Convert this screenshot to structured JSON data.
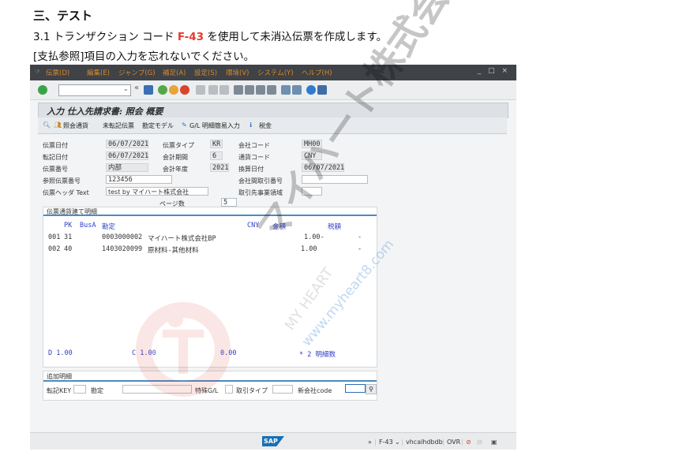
{
  "doc": {
    "heading": "三、テスト",
    "line1_pre": "3.1 トランザクション コード ",
    "line1_tcode": "F-43",
    "line1_post": " を使用して未消込伝票を作成します。",
    "line2": "[支払参照]項目の入力を忘れないでください。"
  },
  "menu": {
    "items": [
      "伝票(D)",
      "編集(E)",
      "ジャンプ(G)",
      "補足(A)",
      "設定(S)",
      "環境(V)",
      "システム(Y)",
      "ヘルプ(H)"
    ]
  },
  "screen": {
    "title": "入力 仕入先請求書: 照会 概要",
    "app_toolbar": [
      "照会通貨",
      "未転記伝票",
      "勘定モデル",
      "G/L 明細簡易入力",
      "税金"
    ]
  },
  "header": {
    "doc_date_label": "伝票日付",
    "doc_date": "06/07/2021",
    "doc_type_label": "伝票タイプ",
    "doc_type": "KR",
    "company_code_label": "会社コード",
    "company_code": "MH00",
    "posting_date_label": "転記日付",
    "posting_date": "06/07/2021",
    "period_label": "会計期間",
    "period": "6",
    "currency_label": "通貨コード",
    "currency": "CNY",
    "doc_no_label": "伝票番号",
    "doc_no": "内部",
    "fiscal_year_label": "会計年度",
    "fiscal_year": "2021",
    "translation_date_label": "換算日付",
    "translation_date": "06/07/2021",
    "reference_label": "参照伝票番号",
    "reference": "123456",
    "intercompany_label": "会社間取引番号",
    "intercompany": "",
    "header_text_label": "伝票ヘッダ Text",
    "header_text": "test by マイハート株式会社",
    "trading_partner_label": "取引先事業領域",
    "trading_partner": "",
    "pages_label": "ページ数",
    "pages": "5"
  },
  "items": {
    "section_title": "伝票通貨建て明細",
    "col_pk": "PK",
    "col_busa": "BusA",
    "col_account": "勘定",
    "col_currency": "CNY",
    "col_amount": "金額",
    "col_tax": "税額",
    "rows": [
      {
        "no": "001",
        "pk": "31",
        "account": "0003000002",
        "name": "マイハート株式会社BP",
        "amount": "1.00-",
        "tax": "-"
      },
      {
        "no": "002",
        "pk": "40",
        "account": "1403020099",
        "name": "原材料-其他材料",
        "amount": "1.00",
        "tax": "-"
      }
    ],
    "debit": "D 1.00",
    "credit": "C 1.00",
    "balance": "0.00",
    "items_count_label": "*   2 明細数"
  },
  "additional": {
    "section_title": "追加明細",
    "posting_key_label": "転記KEY",
    "account_label": "勘定",
    "special_gl_label": "特殊G/L",
    "trans_type_label": "取引タイプ",
    "new_company_label": "新会社code"
  },
  "status": {
    "logo": "SAP",
    "tcode": "F-43",
    "server": "vhcalhdbdb",
    "mode": "OVR"
  },
  "watermark": {
    "company": "マイハート株式会社",
    "english": "MY HEART",
    "url": "www.myheart8.com"
  }
}
